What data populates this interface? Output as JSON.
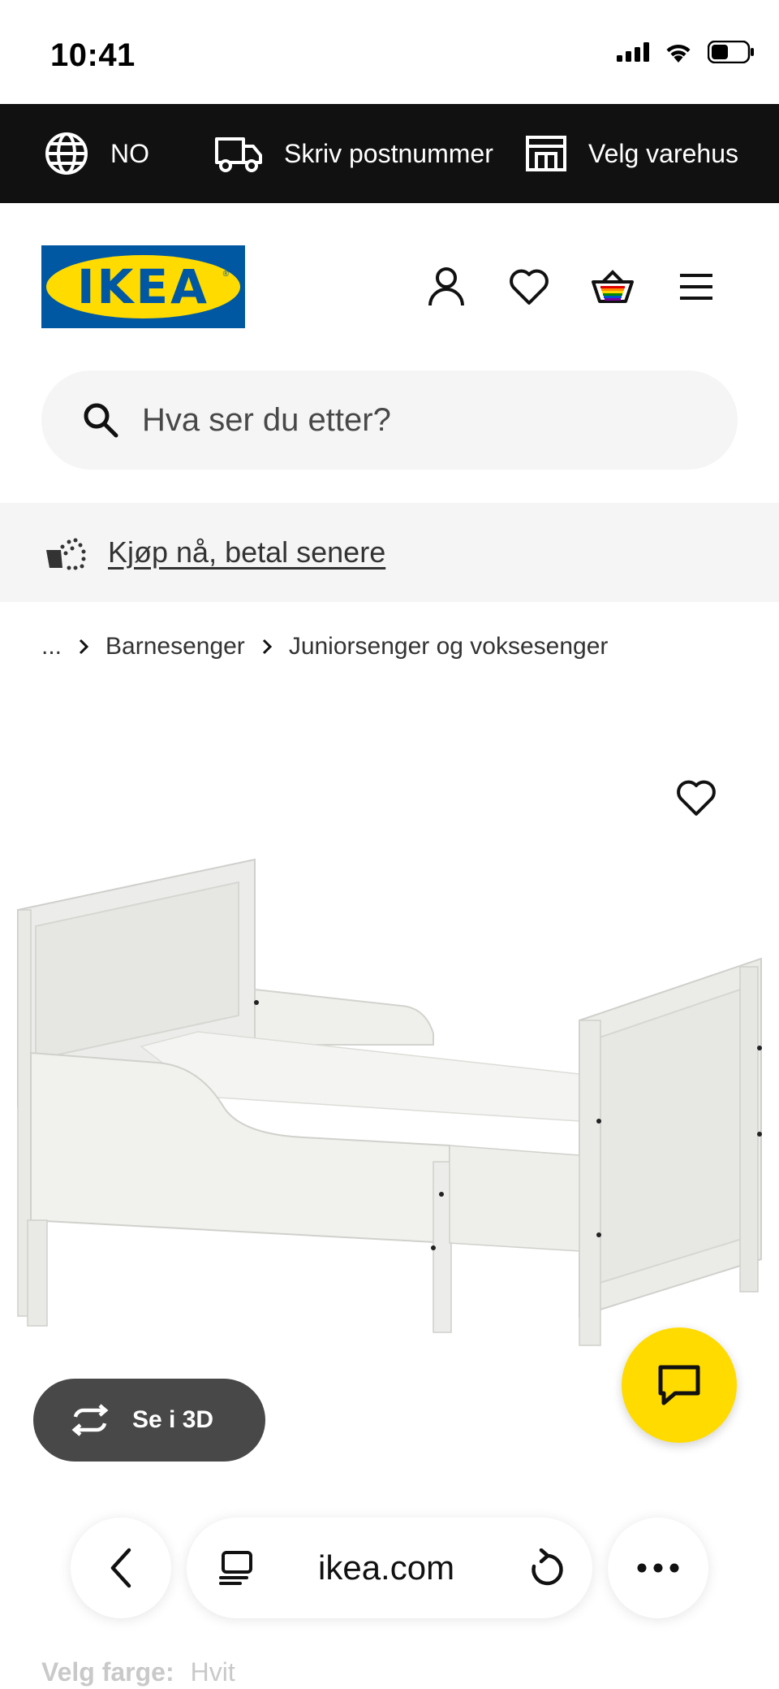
{
  "status_bar": {
    "time": "10:41"
  },
  "utility_bar": {
    "language": "NO",
    "postcode_label": "Skriv postnummer",
    "store_label": "Velg varehus"
  },
  "header": {
    "logo_text": "IKEA",
    "logo_trademark": "®"
  },
  "search": {
    "placeholder": "Hva ser du etter?"
  },
  "promo": {
    "link_text": "Kjøp nå, betal senere"
  },
  "breadcrumb": {
    "ellipsis": "...",
    "items": [
      "Barnesenger",
      "Juniorsenger og voksesenger"
    ]
  },
  "product": {
    "view_3d_label": "Se i 3D",
    "image_count": 4,
    "active_image": 1
  },
  "browser": {
    "url": "ikea.com"
  },
  "color_selector": {
    "label": "Velg farge:",
    "value": "Hvit"
  },
  "colors": {
    "ikea_blue": "#0058a3",
    "ikea_yellow": "#ffdb00",
    "utility_bar_bg": "#111111",
    "search_bg": "#f5f5f5",
    "btn_3d_bg": "#484848"
  }
}
